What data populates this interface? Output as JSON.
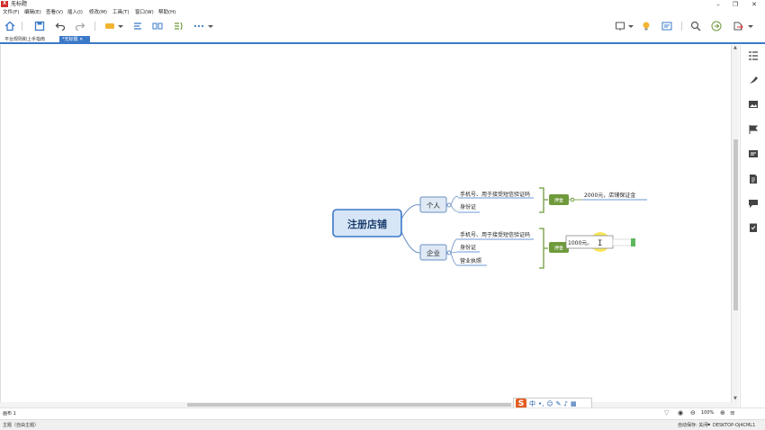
{
  "app": {
    "title": "无标题",
    "icon_label": "X"
  },
  "window_controls": [
    "minimize-icon",
    "restore-icon",
    "close-icon"
  ],
  "menu": [
    "文件(F)",
    "编辑(E)",
    "查看(V)",
    "插入(I)",
    "修改(M)",
    "工具(T)",
    "窗口(W)",
    "帮助(H)"
  ],
  "tabs": [
    {
      "label": "平台规则和上手指南"
    },
    {
      "label": "*无标题 ✕"
    }
  ],
  "mindmap": {
    "root": "注册店铺",
    "branch_person": "个人",
    "branch_company": "企业",
    "person_items": [
      "手机号、用于接受短信验证码",
      "身份证"
    ],
    "company_items": [
      "手机号、用于接受短信验证码",
      "身份证",
      "营业执照"
    ],
    "summary_label": "押金",
    "person_deposit": "2000元，店铺保证金",
    "company_deposit_input": "1000元。"
  },
  "sheet": {
    "tab": "画布 1",
    "zoom": "100%"
  },
  "status": {
    "left": "主题（自由主题）",
    "autosave": "自动保存: 关闭",
    "computer": "DESKTOP-OJ4CML1"
  },
  "ime": {
    "lang": "中"
  },
  "colors": {
    "accent": "#3a78c8",
    "root_fill": "#d6e6f7",
    "summary_green": "#6f9a3c"
  }
}
